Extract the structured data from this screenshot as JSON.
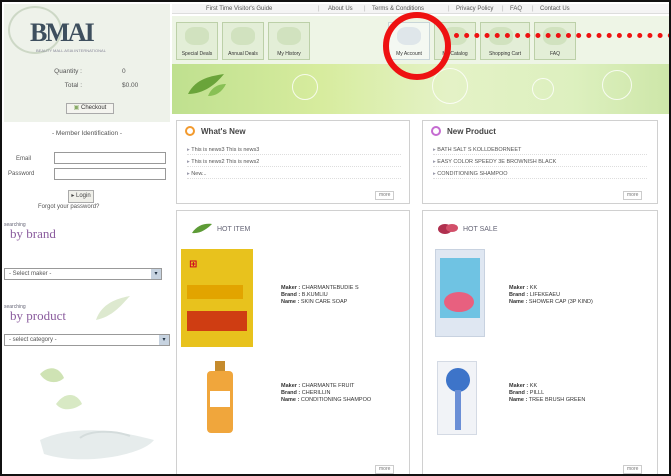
{
  "logo": {
    "text": "BMAI",
    "subtitle": "BEAUTY MALL ASIA INTERNATIONAL"
  },
  "cart": {
    "quantity_label": "Quantity :",
    "quantity_value": "0",
    "total_label": "Total :",
    "total_value": "$0.00",
    "checkout_label": "Checkout"
  },
  "member": {
    "title": "- Member Identification -",
    "email_label": "Email",
    "password_label": "Password",
    "login_label": "Login",
    "forgot_label": "Forgot your password?"
  },
  "brand": {
    "small": "searching",
    "big": "by brand",
    "select_value": "- Select maker -"
  },
  "product_search": {
    "small": "searching",
    "big": "by product",
    "select_value": "- select category -"
  },
  "topnav": [
    "First Time Visitor's Guide",
    "About Us",
    "Terms & Conditions",
    "Privacy Policy",
    "FAQ",
    "Contact Us"
  ],
  "tabs": [
    "Special Deals",
    "Annual Deals",
    "My History",
    "My Account",
    "My Catalog",
    "Shopping Cart",
    "FAQ"
  ],
  "whats_new": {
    "title": "What's New",
    "items": [
      "This is news3 This is news3",
      "This is news2 This is news2",
      "New..."
    ],
    "more": "more"
  },
  "new_product": {
    "title": "New Product",
    "items": [
      "BATH SALT S KOLLDEBORNEET",
      "EASY COLOR SPEEDY 3E BROWNISH BLACK",
      "CONDITIONING SHAMPOO"
    ],
    "more": "more"
  },
  "hot_item": {
    "title": "HOT ITEM",
    "products": [
      {
        "maker": "CHARMANTEBUDIE S",
        "brand": "B.KUMLIU",
        "name": "SKIN CARE SOAP"
      },
      {
        "maker": "CHARMANTE FRUIT",
        "brand": "CHERILLIN",
        "name": "CONDITIONING SHAMPOO"
      }
    ],
    "more": "more"
  },
  "hot_sale": {
    "title": "HOT SALE",
    "products": [
      {
        "maker": "KK",
        "brand": "LIFEKEAEU",
        "name": "SHOWER CAP (3P KIND)"
      },
      {
        "maker": "KK",
        "brand": "PILLL",
        "name": "TREE BRUSH GREEN"
      }
    ],
    "more": "more"
  },
  "labels": {
    "maker": "Maker :",
    "brand": "Brand :",
    "name": "Name :"
  },
  "colors": {
    "annotation": "#ee1111",
    "accent_green": "#8cc34a",
    "section_purple": "#8a5b9d"
  }
}
